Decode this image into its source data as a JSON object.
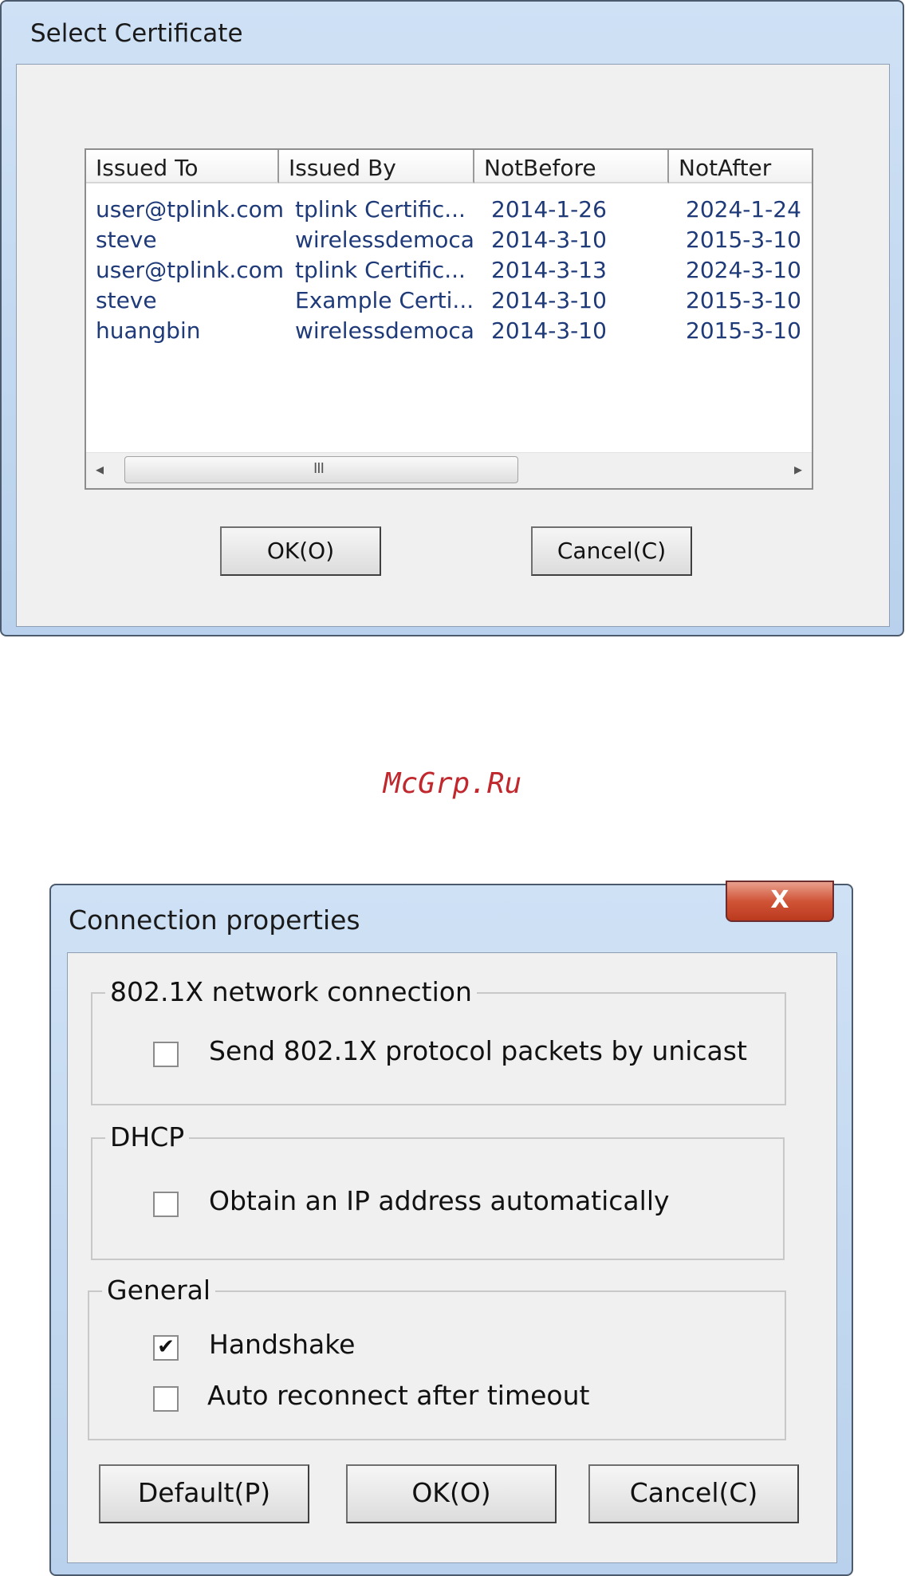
{
  "select_certificate": {
    "title": "Select Certificate",
    "columns": [
      "Issued To",
      "Issued By",
      "NotBefore",
      "NotAfter"
    ],
    "rows": [
      [
        "user@tplink.com",
        "tplink Certific...",
        "2014-1-26",
        "2024-1-24"
      ],
      [
        "steve",
        "wirelessdemoca",
        "2014-3-10",
        "2015-3-10"
      ],
      [
        "user@tplink.com",
        "tplink Certific...",
        "2014-3-13",
        "2024-3-10"
      ],
      [
        "steve",
        "Example Certi...",
        "2014-3-10",
        "2015-3-10"
      ],
      [
        "huangbin",
        "wirelessdemoca",
        "2014-3-10",
        "2015-3-10"
      ]
    ],
    "scrollbar": {
      "grip": "III",
      "left_arrow": "◂",
      "right_arrow": "▸"
    },
    "ok_label": "OK(O)",
    "cancel_label": "Cancel(C)"
  },
  "watermark": "McGrp.Ru",
  "connection_properties": {
    "title": "Connection  properties",
    "close_glyph": "X",
    "groups": [
      {
        "title": "802.1X network connection",
        "options": [
          {
            "label": "Send 802.1X protocol packets by unicast",
            "checked": false
          }
        ]
      },
      {
        "title": "DHCP",
        "options": [
          {
            "label": "Obtain an IP address automatically",
            "checked": false
          }
        ]
      },
      {
        "title": "General",
        "options": [
          {
            "label": "Handshake",
            "checked": true
          },
          {
            "label": "Auto reconnect after timeout",
            "checked": false
          }
        ]
      }
    ],
    "default_label": "Default(P)",
    "ok_label": "OK(O)",
    "cancel_label": "Cancel(C)",
    "check_glyph": "✔"
  },
  "colors": {
    "title_bar": "#c4d9f1",
    "watermark": "#c0282d",
    "list_text": "#1f3a78",
    "close_button": "#c8452a"
  }
}
